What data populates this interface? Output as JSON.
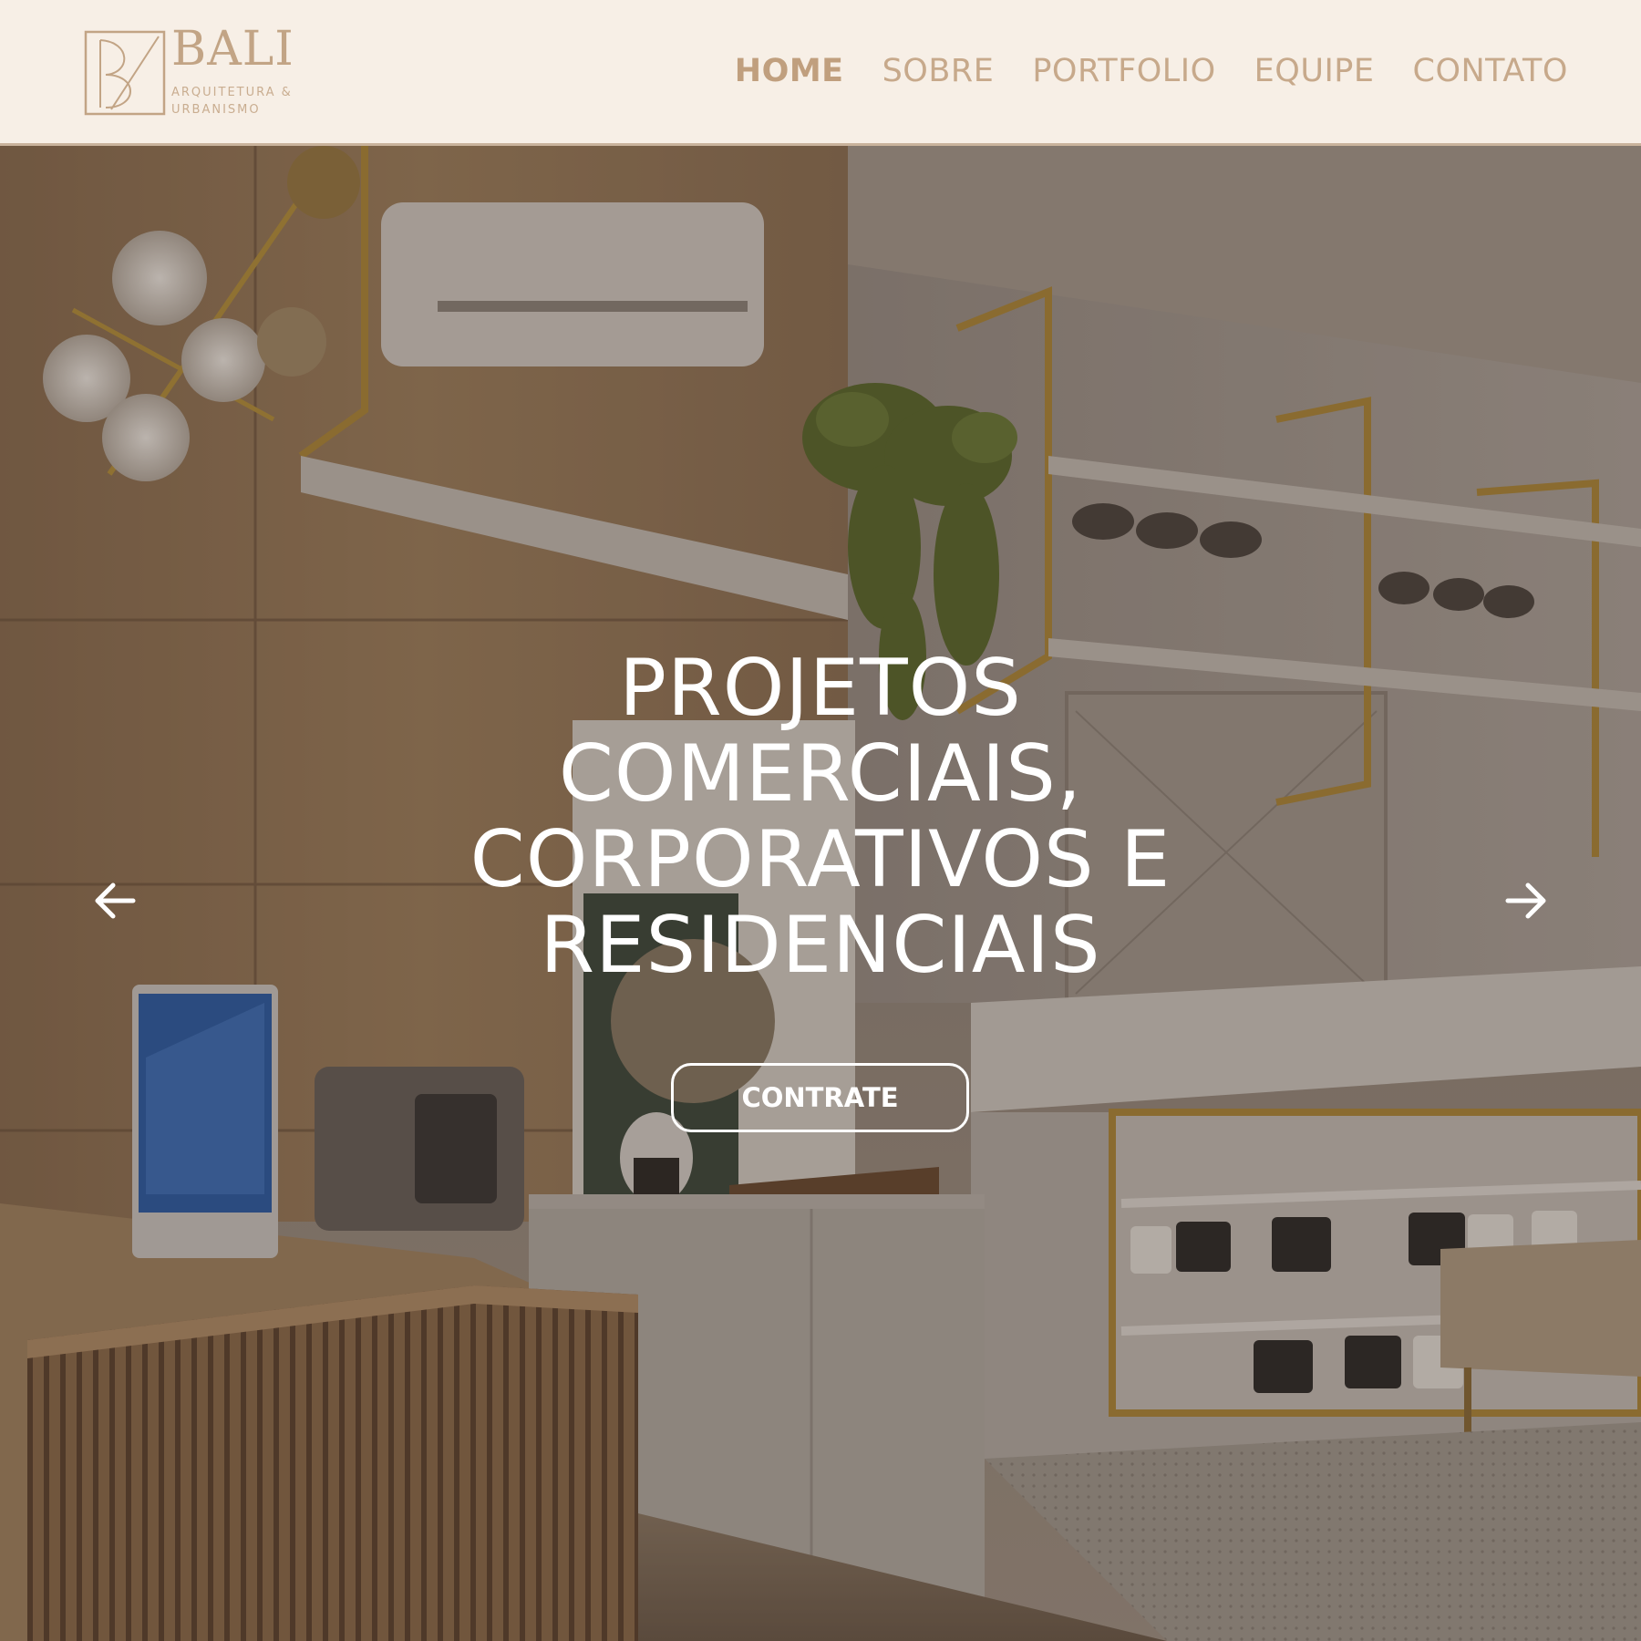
{
  "header": {
    "logo": {
      "name": "BALI",
      "tagline": "ARQUITETURA & URBANISMO"
    },
    "nav": [
      {
        "label": "HOME",
        "active": true
      },
      {
        "label": "SOBRE",
        "active": false
      },
      {
        "label": "PORTFOLIO",
        "active": false
      },
      {
        "label": "EQUIPE",
        "active": false
      },
      {
        "label": "CONTATO",
        "active": false
      }
    ]
  },
  "hero": {
    "heading_lines": [
      "PROJETOS",
      "COMERCIAIS,",
      "CORPORATIVOS E",
      "RESIDENCIAIS"
    ],
    "cta_label": "CONTRATE",
    "prev_icon": "arrow-left-icon",
    "next_icon": "arrow-right-icon"
  },
  "colors": {
    "header_bg": "#f7efe6",
    "brand_gold": "#c2a485",
    "nav_text": "#c7a98b",
    "hero_text": "#ffffff"
  }
}
